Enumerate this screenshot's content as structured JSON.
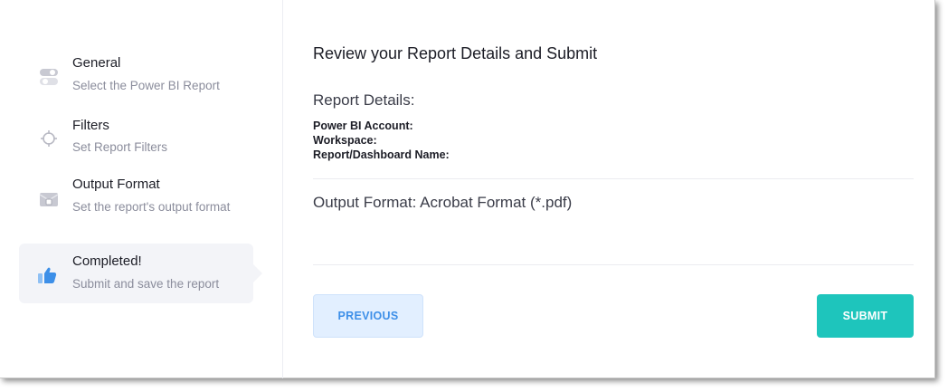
{
  "colors": {
    "accent_blue": "#3d8fe8",
    "submit_teal": "#1ec5bc",
    "active_step_bg": "#f3f4f8"
  },
  "steps": [
    {
      "title": "General",
      "description": "Select the Power BI Report",
      "icon": "toggle-icon"
    },
    {
      "title": "Filters",
      "description": "Set Report Filters",
      "icon": "crosshair-icon"
    },
    {
      "title": "Output Format",
      "description": "Set the report's output format",
      "icon": "envelope-icon"
    },
    {
      "title": "Completed!",
      "description": "Submit and save the report",
      "icon": "thumbs-up-icon",
      "active": true
    }
  ],
  "main": {
    "title": "Review your Report Details and Submit",
    "details_heading": "Report Details:",
    "details": [
      {
        "label": "Power BI Account:",
        "value": ""
      },
      {
        "label": "Workspace:",
        "value": ""
      },
      {
        "label": "Report/Dashboard Name:",
        "value": ""
      }
    ],
    "output_format_label": "Output Format:",
    "output_format_value": "Acrobat Format (*.pdf)"
  },
  "buttons": {
    "previous": "PREVIOUS",
    "submit": "SUBMIT"
  }
}
